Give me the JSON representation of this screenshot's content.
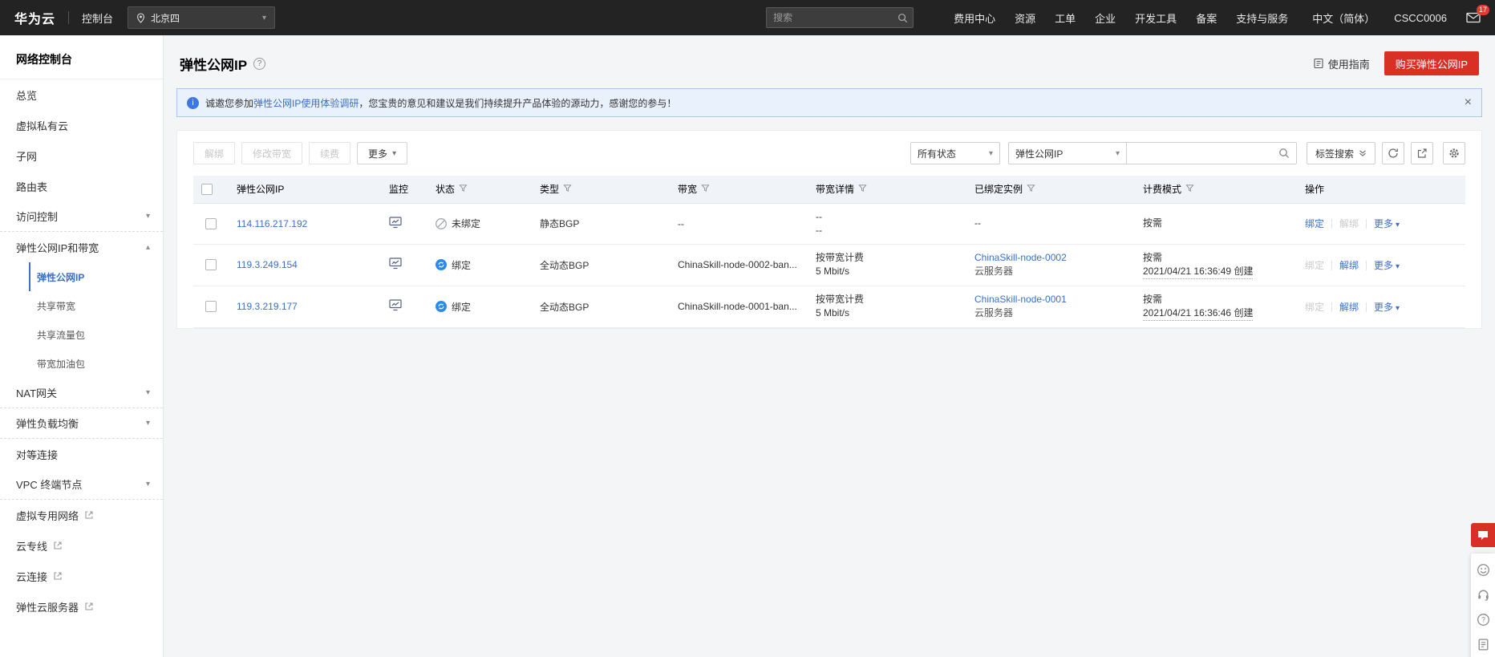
{
  "colors": {
    "brand_red": "#d93026",
    "link_blue": "#3b6fc9",
    "status_bound_blue": "#2e8ae6",
    "topbar_bg": "#232323"
  },
  "topbar": {
    "logo": "华为云",
    "console": "控制台",
    "region": "北京四",
    "search_placeholder": "搜索",
    "links": [
      "费用中心",
      "资源",
      "工单",
      "企业",
      "开发工具",
      "备案",
      "支持与服务"
    ],
    "language": "中文（简体）",
    "account": "CSCC0006",
    "mail_badge": "17"
  },
  "sidebar": {
    "title": "网络控制台",
    "items": [
      {
        "label": "总览"
      },
      {
        "label": "虚拟私有云"
      },
      {
        "label": "子网"
      },
      {
        "label": "路由表"
      },
      {
        "label": "访问控制"
      },
      {
        "label": "弹性公网IP和带宽"
      },
      {
        "label": "弹性公网IP"
      },
      {
        "label": "共享带宽"
      },
      {
        "label": "共享流量包"
      },
      {
        "label": "带宽加油包"
      },
      {
        "label": "NAT网关"
      },
      {
        "label": "弹性负载均衡"
      },
      {
        "label": "对等连接"
      },
      {
        "label": "VPC 终端节点"
      },
      {
        "label": "虚拟专用网络"
      },
      {
        "label": "云专线"
      },
      {
        "label": "云连接"
      },
      {
        "label": "弹性云服务器"
      }
    ]
  },
  "page": {
    "title": "弹性公网IP",
    "guide": "使用指南",
    "buy": "购买弹性公网IP",
    "banner_before": "诚邀您参加",
    "banner_link": "弹性公网IP使用体验调研",
    "banner_after": "，您宝贵的意见和建议是我们持续提升产品体验的源动力，感谢您的参与！"
  },
  "toolbar": {
    "unbind": "解绑",
    "modify": "修改带宽",
    "renew": "续费",
    "more": "更多",
    "status_filter": "所有状态",
    "search_field": "弹性公网IP",
    "tag_search": "标签搜索"
  },
  "table": {
    "headers": [
      "弹性公网IP",
      "监控",
      "状态",
      "类型",
      "带宽",
      "带宽详情",
      "已绑定实例",
      "计费模式",
      "操作"
    ],
    "actions": {
      "bind": "绑定",
      "unbind": "解绑",
      "more": "更多"
    },
    "rows": [
      {
        "ip": "114.116.217.192",
        "status": "未绑定",
        "type": "静态BGP",
        "bandwidth": "--",
        "bw_line1": "--",
        "bw_line2": "--",
        "instance": "--",
        "instance_type": "",
        "billing": "按需",
        "billing_time": ""
      },
      {
        "ip": "119.3.249.154",
        "status": "绑定",
        "type": "全动态BGP",
        "bandwidth": "ChinaSkill-node-0002-ban...",
        "bw_line1": "按带宽计费",
        "bw_line2": "5 Mbit/s",
        "instance": "ChinaSkill-node-0002",
        "instance_type": "云服务器",
        "billing": "按需",
        "billing_time": "2021/04/21 16:36:49 创建"
      },
      {
        "ip": "119.3.219.177",
        "status": "绑定",
        "type": "全动态BGP",
        "bandwidth": "ChinaSkill-node-0001-ban...",
        "bw_line1": "按带宽计费",
        "bw_line2": "5 Mbit/s",
        "instance": "ChinaSkill-node-0001",
        "instance_type": "云服务器",
        "billing": "按需",
        "billing_time": "2021/04/21 16:36:46 创建"
      }
    ]
  }
}
